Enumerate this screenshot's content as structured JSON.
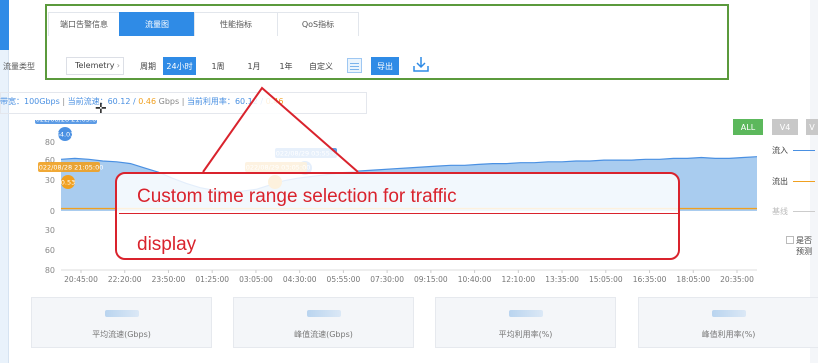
{
  "tabs": [
    {
      "label": "端口告警信息",
      "active": false
    },
    {
      "label": "流量图",
      "active": true
    },
    {
      "label": "性能指标",
      "active": false
    },
    {
      "label": "QoS指标",
      "active": false
    }
  ],
  "toolbar": {
    "traffic_type_label": "流量类型",
    "traffic_type_value": "Telemetry",
    "ranges": [
      {
        "label": "周期",
        "active": false
      },
      {
        "label": "24小时",
        "active": true
      },
      {
        "label": "1周",
        "active": false
      },
      {
        "label": "1月",
        "active": false
      },
      {
        "label": "1年",
        "active": false
      },
      {
        "label": "自定义",
        "active": false
      }
    ],
    "export_label": "导出"
  },
  "info": {
    "bandwidth": "带宽：100Gbps",
    "sep1": " | ",
    "current_rate_label": "当前流速：",
    "current_rate_in": "60.12",
    "slash1": " / ",
    "current_rate_out": "0.46",
    "unit": " Gbps",
    "sep2": " | ",
    "util_label": "当前利用率：",
    "util_in": "60.12",
    "slash2": " / ",
    "util_out": "0.46"
  },
  "series_toggles": [
    {
      "label": "ALL",
      "active": true
    },
    {
      "label": "V4",
      "active": false
    },
    {
      "label": "V",
      "active": false
    }
  ],
  "legend": [
    {
      "label": "流入",
      "color": "#4a90e2"
    },
    {
      "label": "流出",
      "color": "#f0a020"
    },
    {
      "label": "基线",
      "color": "#bbbbbb"
    }
  ],
  "side_checkbox": {
    "line1": "是否",
    "line2": "预测"
  },
  "chart_data": {
    "type": "area",
    "x_ticks": [
      "20:45:00",
      "22:20:00",
      "23:50:00",
      "01:25:00",
      "03:05:00",
      "04:30:00",
      "05:55:00",
      "07:30:00",
      "09:15:00",
      "10:40:00",
      "12:10:00",
      "13:35:00",
      "15:05:00",
      "16:35:00",
      "18:05:00",
      "20:35:00"
    ],
    "y_ticks": [
      "80",
      "60",
      "30",
      "0",
      "30",
      "60",
      "80"
    ],
    "series": [
      {
        "name": "流入",
        "color": "#4a90e2",
        "values": [
          60,
          61,
          60,
          58,
          57,
          55,
          50,
          45,
          38,
          32,
          27,
          24,
          22,
          23,
          25,
          30,
          35,
          38,
          40,
          42,
          44,
          46,
          47,
          48,
          49,
          50,
          51,
          52,
          53,
          53,
          54,
          55,
          55,
          56,
          56,
          57,
          57,
          58,
          58,
          59,
          59,
          59,
          60,
          60,
          61,
          61,
          62,
          61,
          61,
          62,
          63
        ]
      },
      {
        "name": "流出",
        "color": "#f0a020",
        "values": [
          0.5,
          0.5,
          0.5,
          0.5,
          0.5,
          0.5,
          0.5,
          0.5,
          0.5,
          0.5,
          0.5,
          0.5,
          0.5,
          0.5,
          0.5,
          0.5,
          0.5,
          0.5,
          0.5,
          0.5,
          0.5,
          0.5,
          0.5,
          0.5,
          0.5,
          0.5,
          0.5,
          0.5,
          0.5,
          0.5,
          0.5,
          0.5,
          0.5,
          0.5,
          0.5,
          0.5,
          0.5,
          0.5,
          0.5,
          0.5,
          0.5,
          0.5,
          0.5,
          0.5,
          0.5,
          0.5,
          0.5,
          0.5,
          0.5,
          0.5,
          0.46
        ]
      }
    ],
    "markers": [
      {
        "label": "2022/08/28 21:05:00",
        "value": "64.03",
        "series": "流入"
      },
      {
        "label": "2022/08/28 21:05:00",
        "value": "0.53",
        "series": "流出"
      },
      {
        "label": "2022/08/29 03:55:00",
        "value": "",
        "series": "流入"
      },
      {
        "label": "2022/08/29 03:05:00",
        "value": "",
        "series": "流出"
      }
    ]
  },
  "callout": {
    "line1": "Custom time range selection for traffic",
    "line2": "display"
  },
  "cards": [
    {
      "label": "平均流速(Gbps)"
    },
    {
      "label": "峰值流速(Gbps)"
    },
    {
      "label": "平均利用率(%)"
    },
    {
      "label": "峰值利用率(%)"
    }
  ]
}
